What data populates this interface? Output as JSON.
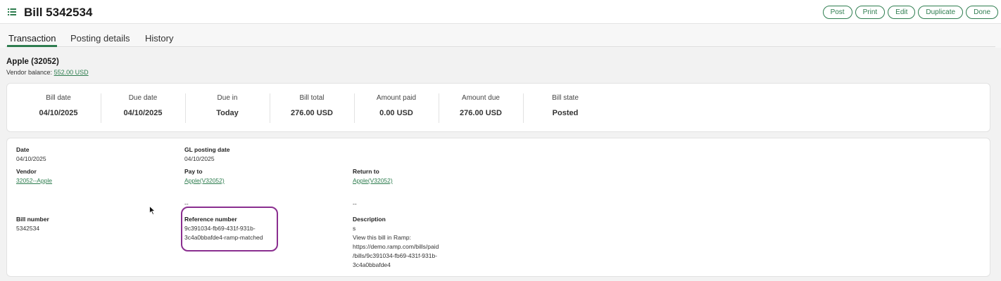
{
  "header": {
    "title": "Bill 5342534",
    "actions": [
      "Post",
      "Print",
      "Edit",
      "Duplicate",
      "Done"
    ]
  },
  "tabs": [
    "Transaction",
    "Posting details",
    "History"
  ],
  "vendor": {
    "name": "Apple (32052)",
    "balance_label": "Vendor balance:",
    "balance_value": "552.00 USD"
  },
  "summary": [
    {
      "label": "Bill date",
      "value": "04/10/2025"
    },
    {
      "label": "Due date",
      "value": "04/10/2025"
    },
    {
      "label": "Due in",
      "value": "Today"
    },
    {
      "label": "Bill total",
      "value": "276.00 USD"
    },
    {
      "label": "Amount paid",
      "value": "0.00 USD"
    },
    {
      "label": "Amount due",
      "value": "276.00 USD"
    },
    {
      "label": "Bill state",
      "value": "Posted"
    }
  ],
  "details": {
    "date": {
      "label": "Date",
      "value": "04/10/2025"
    },
    "gl_posting_date": {
      "label": "GL posting date",
      "value": "04/10/2025"
    },
    "vendor": {
      "label": "Vendor",
      "value": "32052--Apple"
    },
    "pay_to": {
      "label": "Pay to",
      "value": "Apple(V32052)",
      "extra": "--"
    },
    "return_to": {
      "label": "Return to",
      "value": "Apple(V32052)",
      "extra": "--"
    },
    "bill_number": {
      "label": "Bill number",
      "value": "5342534"
    },
    "reference_number": {
      "label": "Reference number",
      "lines": [
        "9c391034-fb69-431f-931b-",
        "3c4a0bbafde4-ramp-matched"
      ]
    },
    "description": {
      "label": "Description",
      "lines": [
        "s",
        "View this bill in Ramp:",
        "https://demo.ramp.com/bills/paid",
        "/bills/9c391034-fb69-431f-931b-",
        "3c4a0bbafde4"
      ]
    }
  },
  "colors": {
    "accent": "#2e7d4f",
    "highlight": "#8a2e8f"
  },
  "icons": {
    "menu": "list-icon",
    "cursor": "mouse-pointer-icon"
  }
}
